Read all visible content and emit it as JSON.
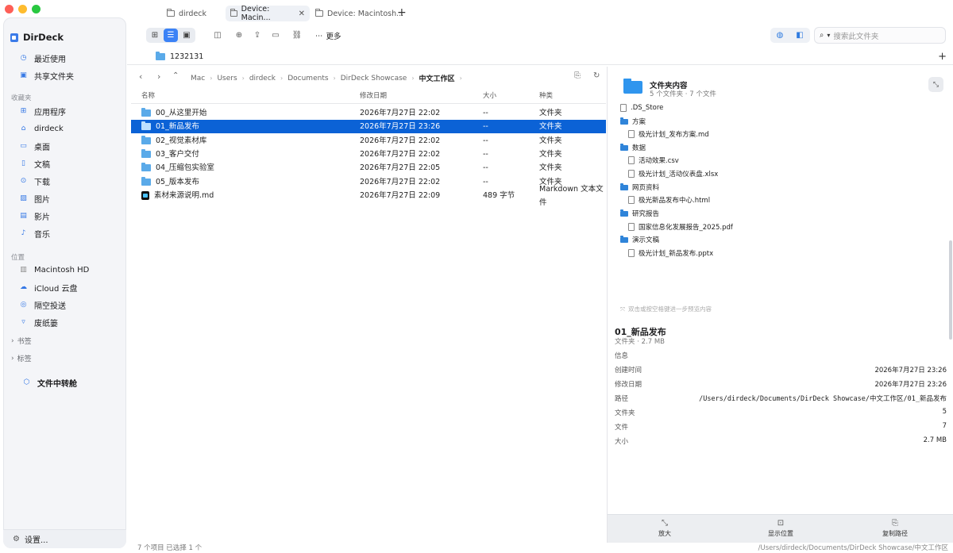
{
  "app": {
    "name": "DirDeck"
  },
  "tabs": [
    {
      "label": "dirdeck",
      "active": false
    },
    {
      "label": "Device: Macin...",
      "active": true
    },
    {
      "label": "Device: Macintosh...",
      "active": false
    }
  ],
  "toolbar": {
    "more_label": "更多",
    "search_placeholder": "搜索此文件夹"
  },
  "sidebar": {
    "top_items": [
      {
        "label": "最近使用",
        "icon": "clock-icon"
      },
      {
        "label": "共享文件夹",
        "icon": "shared-folder-icon"
      }
    ],
    "favorites_title": "收藏夹",
    "favorites": [
      {
        "label": "应用程序",
        "icon": "apps-icon"
      },
      {
        "label": "dirdeck",
        "icon": "home-icon"
      },
      {
        "label": "桌面",
        "icon": "desktop-icon"
      },
      {
        "label": "文稿",
        "icon": "document-icon"
      },
      {
        "label": "下载",
        "icon": "download-icon"
      },
      {
        "label": "图片",
        "icon": "photo-icon"
      },
      {
        "label": "影片",
        "icon": "film-icon"
      },
      {
        "label": "音乐",
        "icon": "music-icon"
      }
    ],
    "locations_title": "位置",
    "locations": [
      {
        "label": "Macintosh HD",
        "icon": "disk-icon"
      },
      {
        "label": "iCloud 云盘",
        "icon": "cloud-icon"
      },
      {
        "label": "隔空投送",
        "icon": "airdrop-icon"
      },
      {
        "label": "废纸篓",
        "icon": "trash-icon"
      }
    ],
    "bookmarks_label": "书签",
    "tags_label": "标签",
    "transfer_label": "文件中转舱",
    "settings_label": "设置..."
  },
  "pinned": {
    "label": "1232131"
  },
  "breadcrumb": [
    "Mac",
    "Users",
    "dirdeck",
    "Documents",
    "DirDeck Showcase",
    "中文工作区"
  ],
  "table": {
    "headers": {
      "name": "名称",
      "modified": "修改日期",
      "size": "大小",
      "kind": "种类"
    },
    "rows": [
      {
        "name": "00_从这里开始",
        "modified": "2026年7月27日 22:02",
        "size": "--",
        "kind": "文件夹",
        "selected": false,
        "type": "folder"
      },
      {
        "name": "01_新品发布",
        "modified": "2026年7月27日 23:26",
        "size": "--",
        "kind": "文件夹",
        "selected": true,
        "type": "folder"
      },
      {
        "name": "02_视觉素材库",
        "modified": "2026年7月27日 22:02",
        "size": "--",
        "kind": "文件夹",
        "selected": false,
        "type": "folder"
      },
      {
        "name": "03_客户交付",
        "modified": "2026年7月27日 22:02",
        "size": "--",
        "kind": "文件夹",
        "selected": false,
        "type": "folder"
      },
      {
        "name": "04_压缩包实验室",
        "modified": "2026年7月27日 22:05",
        "size": "--",
        "kind": "文件夹",
        "selected": false,
        "type": "folder"
      },
      {
        "name": "05_版本发布",
        "modified": "2026年7月27日 22:02",
        "size": "--",
        "kind": "文件夹",
        "selected": false,
        "type": "folder"
      },
      {
        "name": "素材来源说明.md",
        "modified": "2026年7月27日 22:09",
        "size": "489 字节",
        "kind": "Markdown 文本文件",
        "selected": false,
        "type": "markdown"
      }
    ]
  },
  "preview": {
    "title": "文件夹内容",
    "subtitle": "5 个文件夹 · 7 个文件",
    "tree": [
      {
        "label": ".DS_Store",
        "type": "file",
        "level": 0
      },
      {
        "label": "方案",
        "type": "folder",
        "level": 0
      },
      {
        "label": "极光计划_发布方案.md",
        "type": "file",
        "level": 1
      },
      {
        "label": "数据",
        "type": "folder",
        "level": 0
      },
      {
        "label": "活动效果.csv",
        "type": "file",
        "level": 1
      },
      {
        "label": "极光计划_活动仪表盘.xlsx",
        "type": "file",
        "level": 1
      },
      {
        "label": "网页资料",
        "type": "folder",
        "level": 0
      },
      {
        "label": "极光新品发布中心.html",
        "type": "file",
        "level": 1
      },
      {
        "label": "研究报告",
        "type": "folder",
        "level": 0
      },
      {
        "label": "国家信息化发展报告_2025.pdf",
        "type": "file",
        "level": 1
      },
      {
        "label": "演示文稿",
        "type": "folder",
        "level": 0
      },
      {
        "label": "极光计划_新品发布.pptx",
        "type": "file",
        "level": 1
      }
    ],
    "hint": "双击或按空格键进一步预览内容",
    "selected_name": "01_新品发布",
    "selected_meta": "文件夹 · 2.7 MB",
    "info_title": "信息",
    "info": [
      {
        "label": "创建时间",
        "value": "2026年7月27日 23:26"
      },
      {
        "label": "修改日期",
        "value": "2026年7月27日 23:26"
      },
      {
        "label": "路径",
        "value": "/Users/dirdeck/Documents/DirDeck Showcase/中文工作区/01_新品发布",
        "mono": true
      },
      {
        "label": "文件夹",
        "value": "5"
      },
      {
        "label": "文件",
        "value": "7"
      },
      {
        "label": "大小",
        "value": "2.7 MB"
      }
    ],
    "actions": [
      {
        "label": "放大",
        "icon": "zoom-icon"
      },
      {
        "label": "显示位置",
        "icon": "reveal-icon"
      },
      {
        "label": "复制路径",
        "icon": "copy-icon"
      }
    ]
  },
  "status": {
    "left": "7 个项目   已选择 1 个",
    "right": "/Users/dirdeck/Documents/DirDeck Showcase/中文工作区"
  },
  "colors": {
    "accent": "#0b62d6",
    "folder": "#5aaae9",
    "sidebar_bg": "#f4f5f8"
  }
}
